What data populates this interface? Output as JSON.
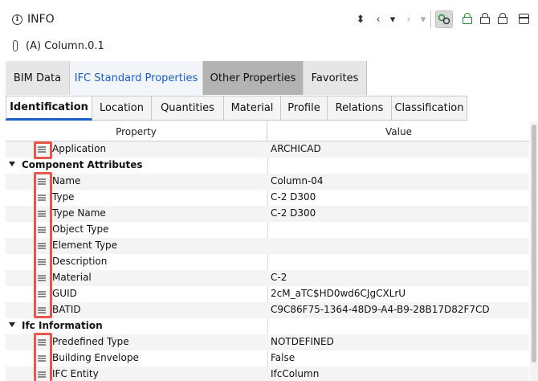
{
  "header": {
    "title": "INFO",
    "element": "(A) Column.0.1"
  },
  "main_tabs": [
    {
      "label": "BIM Data"
    },
    {
      "label": "IFC Standard Properties"
    },
    {
      "label": "Other Properties"
    },
    {
      "label": "Favorites"
    }
  ],
  "sub_tabs": [
    {
      "label": "Identification"
    },
    {
      "label": "Location"
    },
    {
      "label": "Quantities"
    },
    {
      "label": "Material"
    },
    {
      "label": "Profile"
    },
    {
      "label": "Relations"
    },
    {
      "label": "Classification"
    }
  ],
  "table": {
    "headers": {
      "property": "Property",
      "value": "Value"
    },
    "rows": [
      {
        "label": "Application",
        "value": "ARCHICAD"
      },
      {
        "label": "Component Attributes",
        "value": ""
      },
      {
        "label": "Name",
        "value": "Column-04"
      },
      {
        "label": "Type",
        "value": "C-2 D300"
      },
      {
        "label": "Type Name",
        "value": "C-2 D300"
      },
      {
        "label": "Object Type",
        "value": ""
      },
      {
        "label": "Element Type",
        "value": ""
      },
      {
        "label": "Description",
        "value": ""
      },
      {
        "label": "Material",
        "value": "C-2"
      },
      {
        "label": "GUID",
        "value": "2cM_aTC$HD0wd6CJgCXLrU"
      },
      {
        "label": "BATID",
        "value": "C9C86F75-1364-48D9-A4-B9-28B17D82F7CD"
      },
      {
        "label": "Ifc Information",
        "value": ""
      },
      {
        "label": "Predefined Type",
        "value": "NOTDEFINED"
      },
      {
        "label": "Building Envelope",
        "value": "False"
      },
      {
        "label": "IFC Entity",
        "value": "IfcColumn"
      }
    ]
  },
  "colors": {
    "accent": "#1a5ec8",
    "highlight": "#e8574a",
    "active_tab": "#b3b3b3"
  }
}
